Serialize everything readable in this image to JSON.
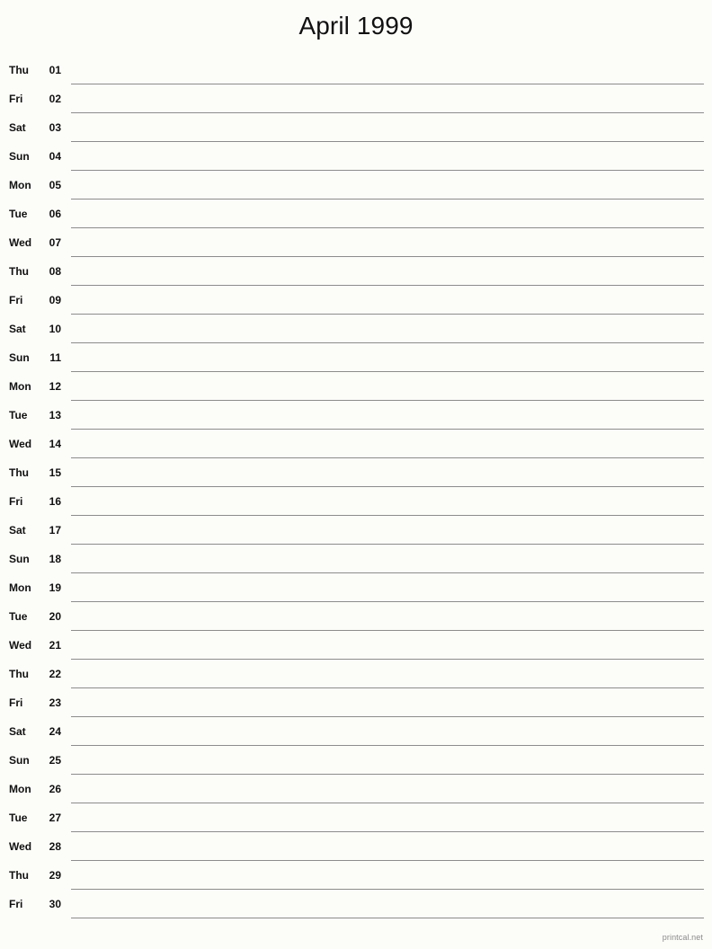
{
  "header": {
    "title": "April 1999"
  },
  "footer": {
    "credit": "printcal.net"
  },
  "colors": {
    "background": "#fcfdf9",
    "text": "#111111",
    "rule": "#8c8c8c",
    "footer_text": "#8a8a8a"
  },
  "calendar": {
    "month": "April",
    "year": "1999",
    "days": [
      {
        "weekday": "Thu",
        "date": "01"
      },
      {
        "weekday": "Fri",
        "date": "02"
      },
      {
        "weekday": "Sat",
        "date": "03"
      },
      {
        "weekday": "Sun",
        "date": "04"
      },
      {
        "weekday": "Mon",
        "date": "05"
      },
      {
        "weekday": "Tue",
        "date": "06"
      },
      {
        "weekday": "Wed",
        "date": "07"
      },
      {
        "weekday": "Thu",
        "date": "08"
      },
      {
        "weekday": "Fri",
        "date": "09"
      },
      {
        "weekday": "Sat",
        "date": "10"
      },
      {
        "weekday": "Sun",
        "date": "11"
      },
      {
        "weekday": "Mon",
        "date": "12"
      },
      {
        "weekday": "Tue",
        "date": "13"
      },
      {
        "weekday": "Wed",
        "date": "14"
      },
      {
        "weekday": "Thu",
        "date": "15"
      },
      {
        "weekday": "Fri",
        "date": "16"
      },
      {
        "weekday": "Sat",
        "date": "17"
      },
      {
        "weekday": "Sun",
        "date": "18"
      },
      {
        "weekday": "Mon",
        "date": "19"
      },
      {
        "weekday": "Tue",
        "date": "20"
      },
      {
        "weekday": "Wed",
        "date": "21"
      },
      {
        "weekday": "Thu",
        "date": "22"
      },
      {
        "weekday": "Fri",
        "date": "23"
      },
      {
        "weekday": "Sat",
        "date": "24"
      },
      {
        "weekday": "Sun",
        "date": "25"
      },
      {
        "weekday": "Mon",
        "date": "26"
      },
      {
        "weekday": "Tue",
        "date": "27"
      },
      {
        "weekday": "Wed",
        "date": "28"
      },
      {
        "weekday": "Thu",
        "date": "29"
      },
      {
        "weekday": "Fri",
        "date": "30"
      }
    ]
  }
}
